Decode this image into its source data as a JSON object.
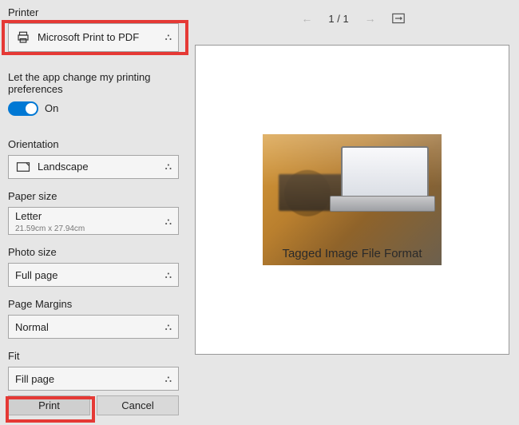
{
  "labels": {
    "printer": "Printer",
    "printerValue": "Microsoft Print to PDF",
    "allowPref": "Let the app change my printing preferences",
    "toggleState": "On",
    "orientation": "Orientation",
    "orientationValue": "Landscape",
    "paperSize": "Paper size",
    "paperSizeValue": "Letter",
    "paperSizeSub": "21.59cm x 27.94cm",
    "photoSize": "Photo size",
    "photoSizeValue": "Full page",
    "pageMargins": "Page Margins",
    "pageMarginsValue": "Normal",
    "fit": "Fit",
    "fitValue": "Fill page",
    "printBtn": "Print",
    "cancelBtn": "Cancel"
  },
  "nav": {
    "current": "1",
    "sep": "/",
    "total": "1"
  },
  "preview": {
    "caption": "Tagged Image File Format"
  }
}
